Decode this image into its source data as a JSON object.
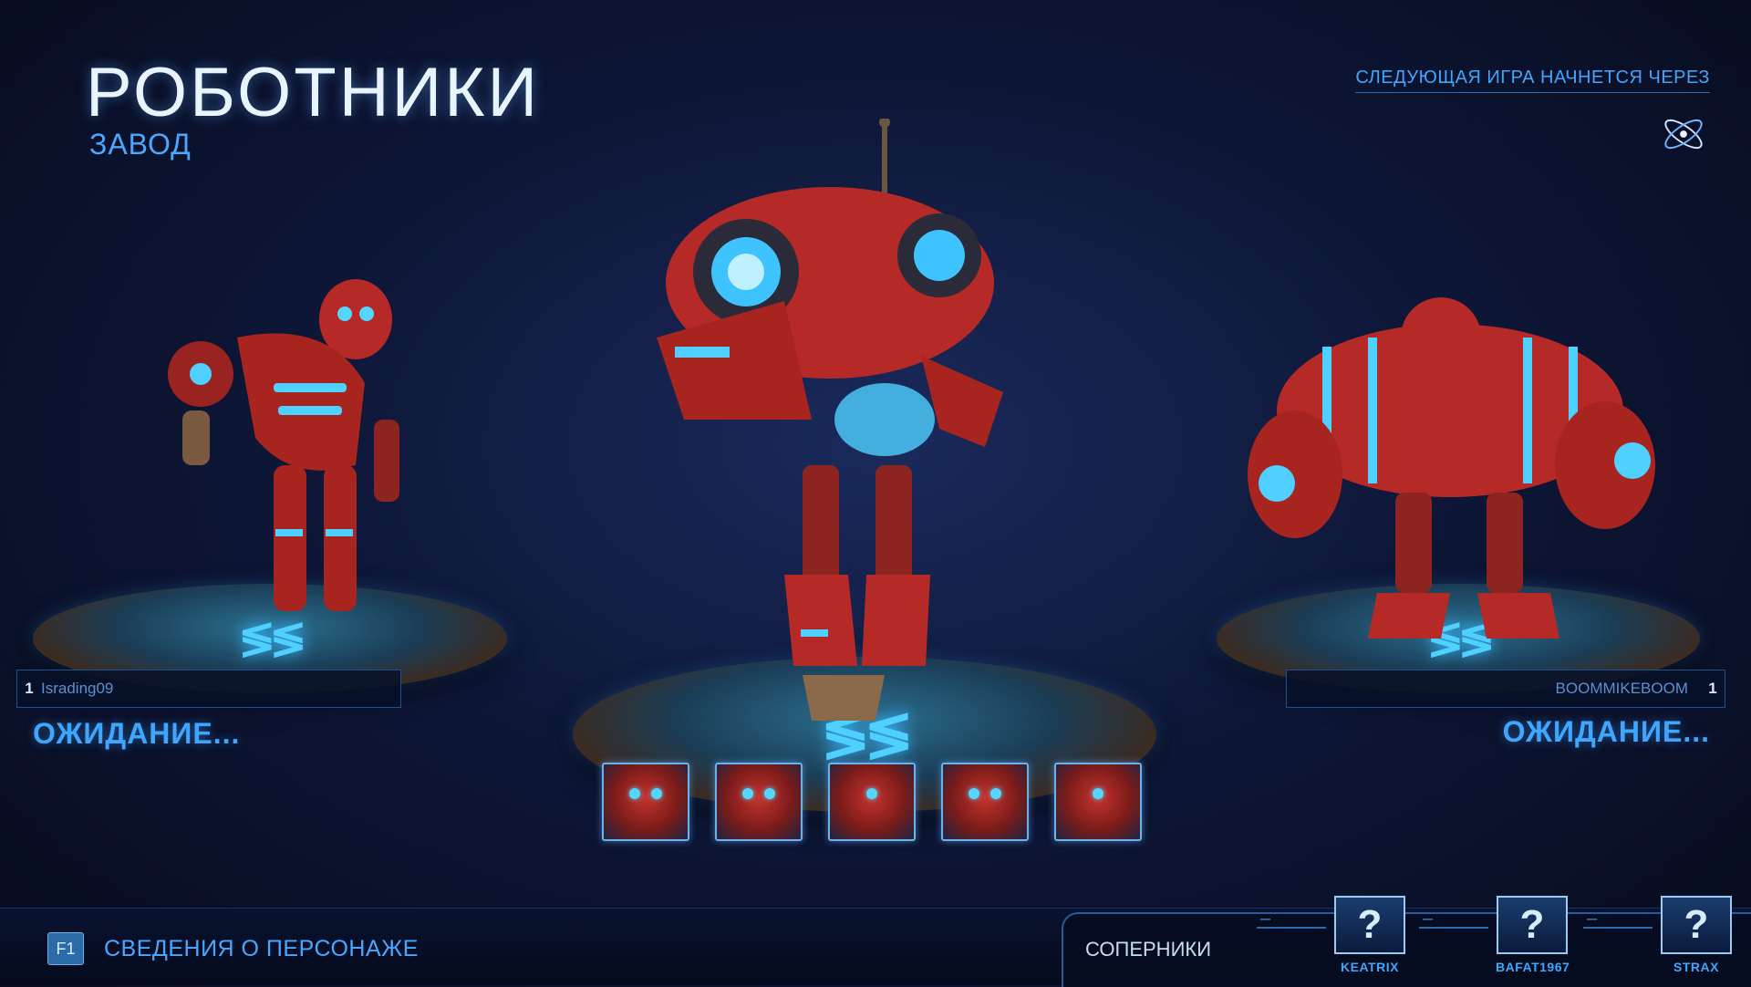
{
  "header": {
    "title": "РОБОТНИКИ",
    "subtitle": "ЗАВОД",
    "next_game": "СЛЕДУЮЩАЯ ИГРА НАЧНЕТСЯ ЧЕРЕЗ",
    "spinner_icon": "atom-spinner-icon"
  },
  "players": [
    {
      "number": "1",
      "name": "Israding09",
      "status": "ОЖИДАНИЕ..."
    },
    {
      "number": "1",
      "name": "BOOMMIKEBOOM",
      "status": "ОЖИДАНИЕ..."
    }
  ],
  "skins": [
    "skin-1",
    "skin-2",
    "skin-3",
    "skin-4",
    "skin-5"
  ],
  "bottom": {
    "key": "F1",
    "hero_info": "СВЕДЕНИЯ О ПЕРСОНАЖЕ"
  },
  "opponents": {
    "label": "СОПЕРНИКИ",
    "list": [
      {
        "placeholder": "?",
        "dash": "–",
        "name": "KEATRIX"
      },
      {
        "placeholder": "?",
        "dash": "–",
        "name": "BAFAT1967"
      },
      {
        "placeholder": "?",
        "dash": "–",
        "name": "STRAX"
      }
    ]
  },
  "colors": {
    "accent": "#3fa6ff",
    "robot_red": "#c5322c",
    "glow": "#4fd0ff"
  }
}
